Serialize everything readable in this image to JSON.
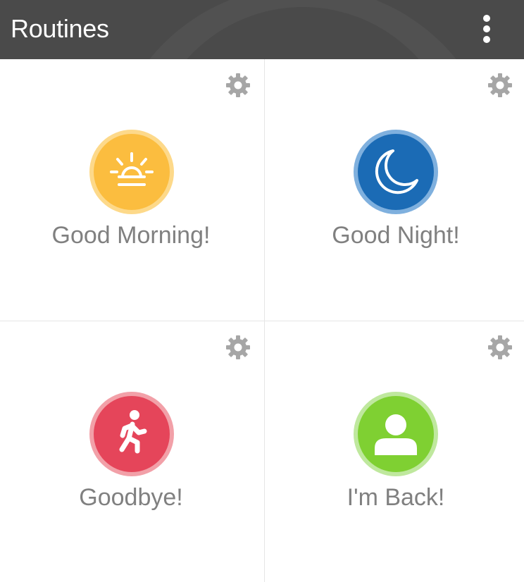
{
  "header": {
    "title": "Routines",
    "menu_icon": "more-vertical-icon",
    "background": "#4a4a4a"
  },
  "routines": [
    {
      "label": "Good Morning!",
      "icon": "sunrise-icon",
      "outer_color": "#fdd98a",
      "inner_color": "#fbbd3f",
      "settings_icon": "gear-icon"
    },
    {
      "label": "Good Night!",
      "icon": "moon-icon",
      "outer_color": "#7fb0de",
      "inner_color": "#1b6bb5",
      "settings_icon": "gear-icon"
    },
    {
      "label": "Goodbye!",
      "icon": "walking-person-icon",
      "outer_color": "#f2a0a8",
      "inner_color": "#e5455a",
      "settings_icon": "gear-icon"
    },
    {
      "label": "I'm Back!",
      "icon": "user-icon",
      "outer_color": "#bfe89e",
      "inner_color": "#7fd032",
      "settings_icon": "gear-icon"
    }
  ],
  "colors": {
    "label": "#808080",
    "gear": "#a6a6a6",
    "divider": "#e6e6e6"
  }
}
